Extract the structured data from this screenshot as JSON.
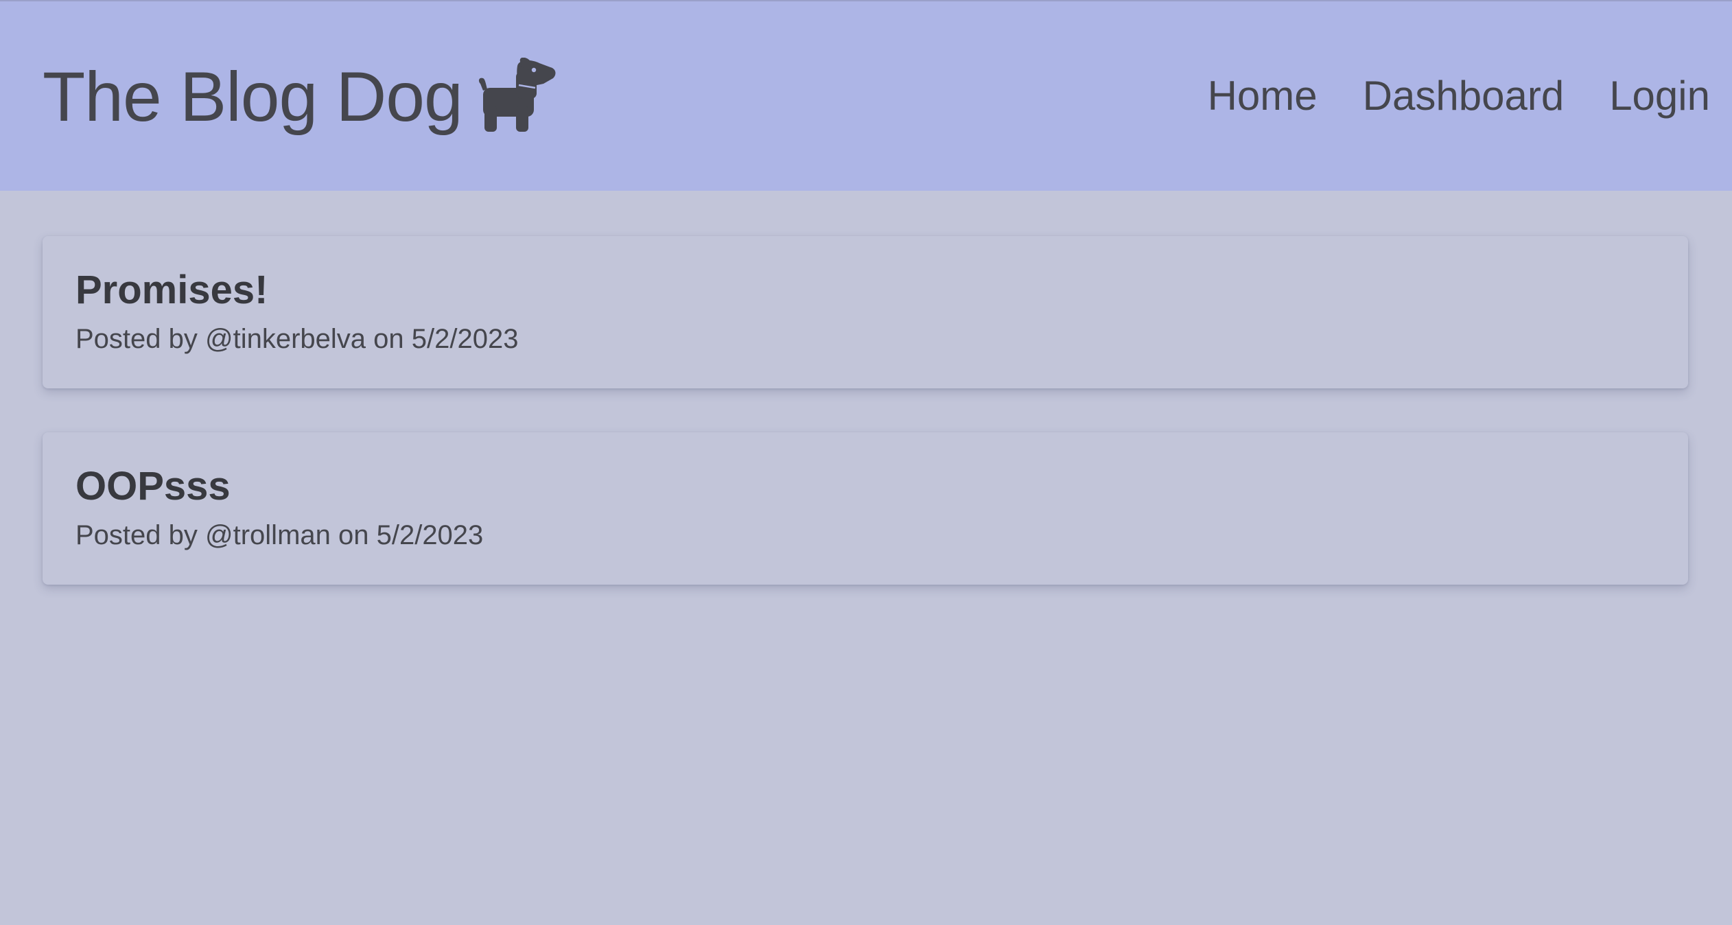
{
  "header": {
    "title": "The Blog Dog",
    "logo_icon": "dog-icon",
    "background_color": "#adb5e6"
  },
  "nav": {
    "items": [
      {
        "label": "Home"
      },
      {
        "label": "Dashboard"
      },
      {
        "label": "Login"
      }
    ]
  },
  "posts": [
    {
      "title": "Promises!",
      "meta": "Posted by @tinkerbelva on 5/2/2023"
    },
    {
      "title": "OOPsss",
      "meta": "Posted by @trollman on 5/2/2023"
    }
  ],
  "colors": {
    "page_background": "#c2c5d9",
    "text": "#45464d"
  }
}
